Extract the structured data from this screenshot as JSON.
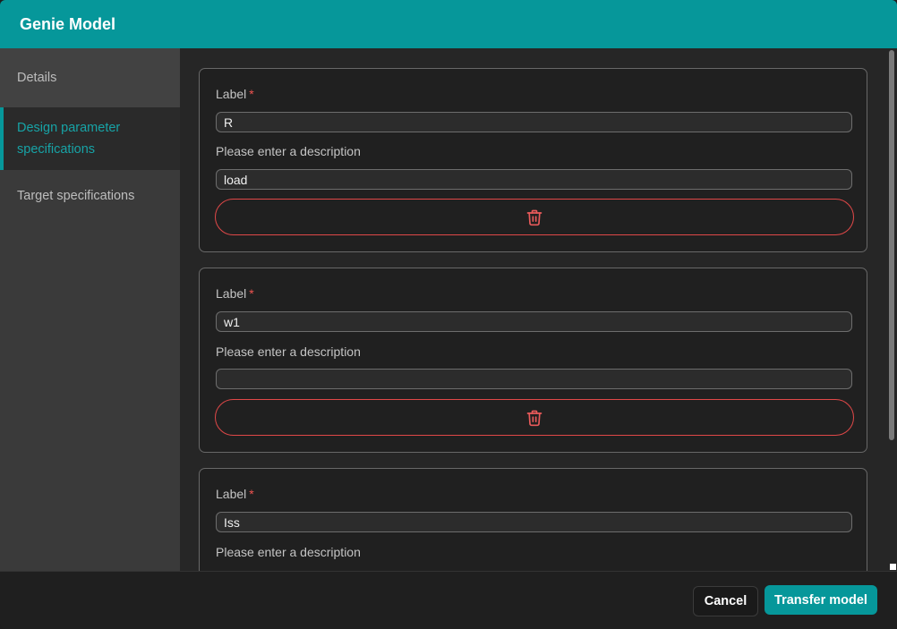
{
  "dialog": {
    "title": "Genie Model"
  },
  "sidebar": {
    "items": [
      {
        "label": "Details"
      },
      {
        "label": "Design parameter specifications"
      },
      {
        "label": "Target specifications"
      }
    ]
  },
  "parameters": [
    {
      "label_title": "Label",
      "required": "*",
      "label_value": "R",
      "description_title": "Please enter a description",
      "description_value": "load"
    },
    {
      "label_title": "Label",
      "required": "*",
      "label_value": "w1",
      "description_title": "Please enter a description",
      "description_value": ""
    },
    {
      "label_title": "Label",
      "required": "*",
      "label_value": "Iss",
      "description_title": "Please enter a description",
      "description_value": ""
    }
  ],
  "footer": {
    "cancel_label": "Cancel",
    "transfer_label": "Transfer model"
  },
  "icons": {
    "delete": "trash-icon"
  },
  "colors": {
    "accent": "#06979a",
    "danger": "#e04848"
  }
}
